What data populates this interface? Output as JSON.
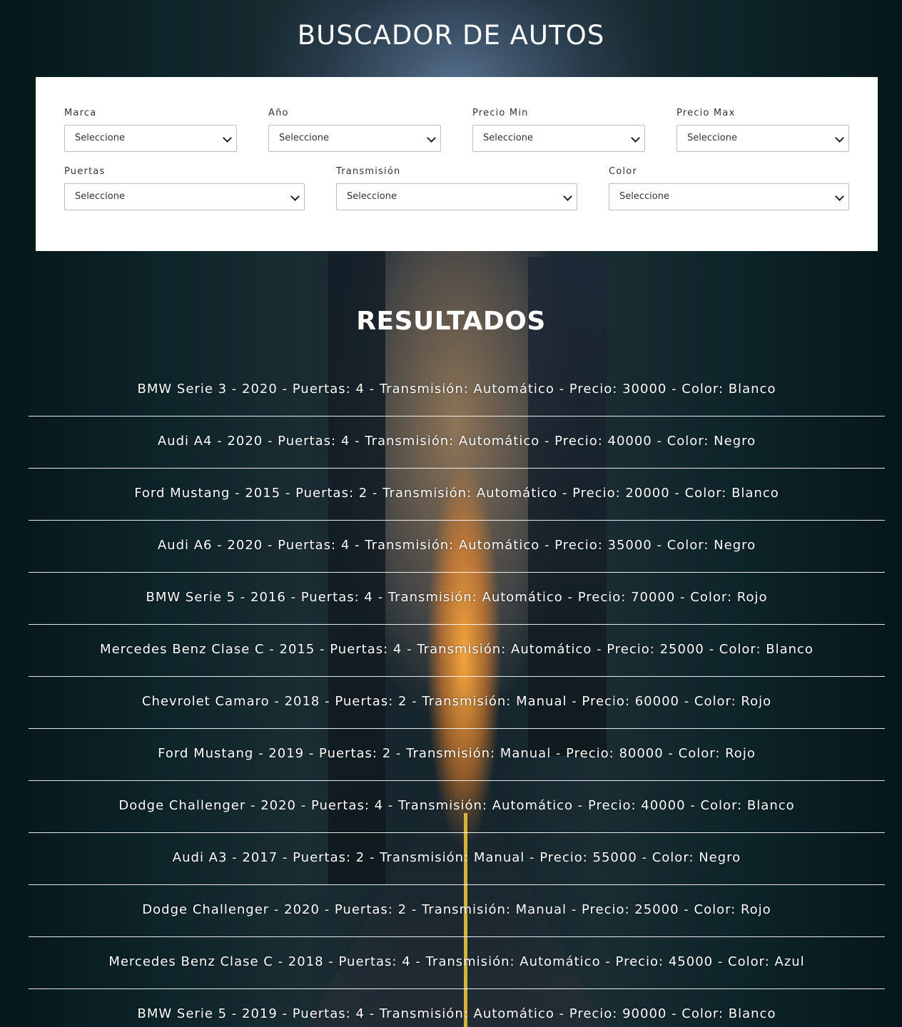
{
  "header": {
    "title": "BUSCADOR DE AUTOS"
  },
  "filters": {
    "marca": {
      "label": "Marca",
      "value": "Seleccione"
    },
    "anio": {
      "label": "Año",
      "value": "Seleccione"
    },
    "precio_min": {
      "label": "Precio Min",
      "value": "Seleccione"
    },
    "precio_max": {
      "label": "Precio Max",
      "value": "Seleccione"
    },
    "puertas": {
      "label": "Puertas",
      "value": "Seleccione"
    },
    "transmision": {
      "label": "Transmisión",
      "value": "Seleccione"
    },
    "color": {
      "label": "Color",
      "value": "Seleccione"
    }
  },
  "results": {
    "title": "RESULTADOS",
    "items": [
      "BMW Serie 3 - 2020 - Puertas: 4 - Transmisión: Automático - Precio: 30000 - Color: Blanco",
      "Audi A4 - 2020 - Puertas: 4 - Transmisión: Automático - Precio: 40000 - Color: Negro",
      "Ford Mustang - 2015 - Puertas: 2 - Transmisión: Automático - Precio: 20000 - Color: Blanco",
      "Audi A6 - 2020 - Puertas: 4 - Transmisión: Automático - Precio: 35000 - Color: Negro",
      "BMW Serie 5 - 2016 - Puertas: 4 - Transmisión: Automático - Precio: 70000 - Color: Rojo",
      "Mercedes Benz Clase C - 2015 - Puertas: 4 - Transmisión: Automático - Precio: 25000 - Color: Blanco",
      "Chevrolet Camaro - 2018 - Puertas: 2 - Transmisión: Manual - Precio: 60000 - Color: Rojo",
      "Ford Mustang - 2019 - Puertas: 2 - Transmisión: Manual - Precio: 80000 - Color: Rojo",
      "Dodge Challenger - 2020 - Puertas: 4 - Transmisión: Automático - Precio: 40000 - Color: Blanco",
      "Audi A3 - 2017 - Puertas: 2 - Transmisión: Manual - Precio: 55000 - Color: Negro",
      "Dodge Challenger - 2020 - Puertas: 2 - Transmisión: Manual - Precio: 25000 - Color: Rojo",
      "Mercedes Benz Clase C - 2018 - Puertas: 4 - Transmisión: Automático - Precio: 45000 - Color: Azul",
      "BMW Serie 5 - 2019 - Puertas: 4 - Transmisión: Automático - Precio: 90000 - Color: Blanco"
    ]
  }
}
